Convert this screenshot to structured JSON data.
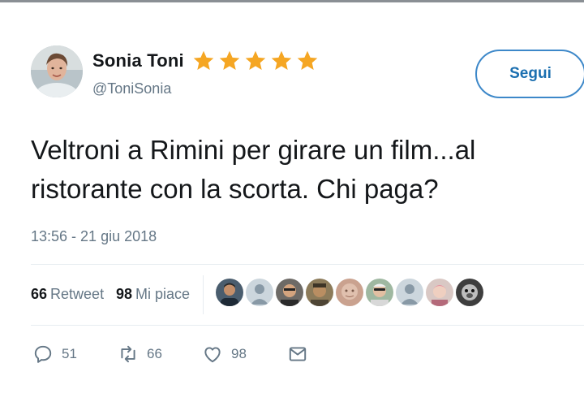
{
  "user": {
    "name": "Sonia Toni",
    "handle": "@ToniSonia",
    "star_color": "#f5a623"
  },
  "follow_label": "Segui",
  "tweet_text": "Veltroni a Rimini per girare un film...al ristorante con la scorta. Chi paga?",
  "timestamp": "13:56 - 21 giu 2018",
  "stats": {
    "retweets_count": "66",
    "retweets_label": "Retweet",
    "likes_count": "98",
    "likes_label": "Mi piace"
  },
  "actions": {
    "reply_count": "51",
    "retweet_count": "66",
    "like_count": "98"
  },
  "colors": {
    "accent": "#1b6fb0",
    "muted": "#657786"
  }
}
